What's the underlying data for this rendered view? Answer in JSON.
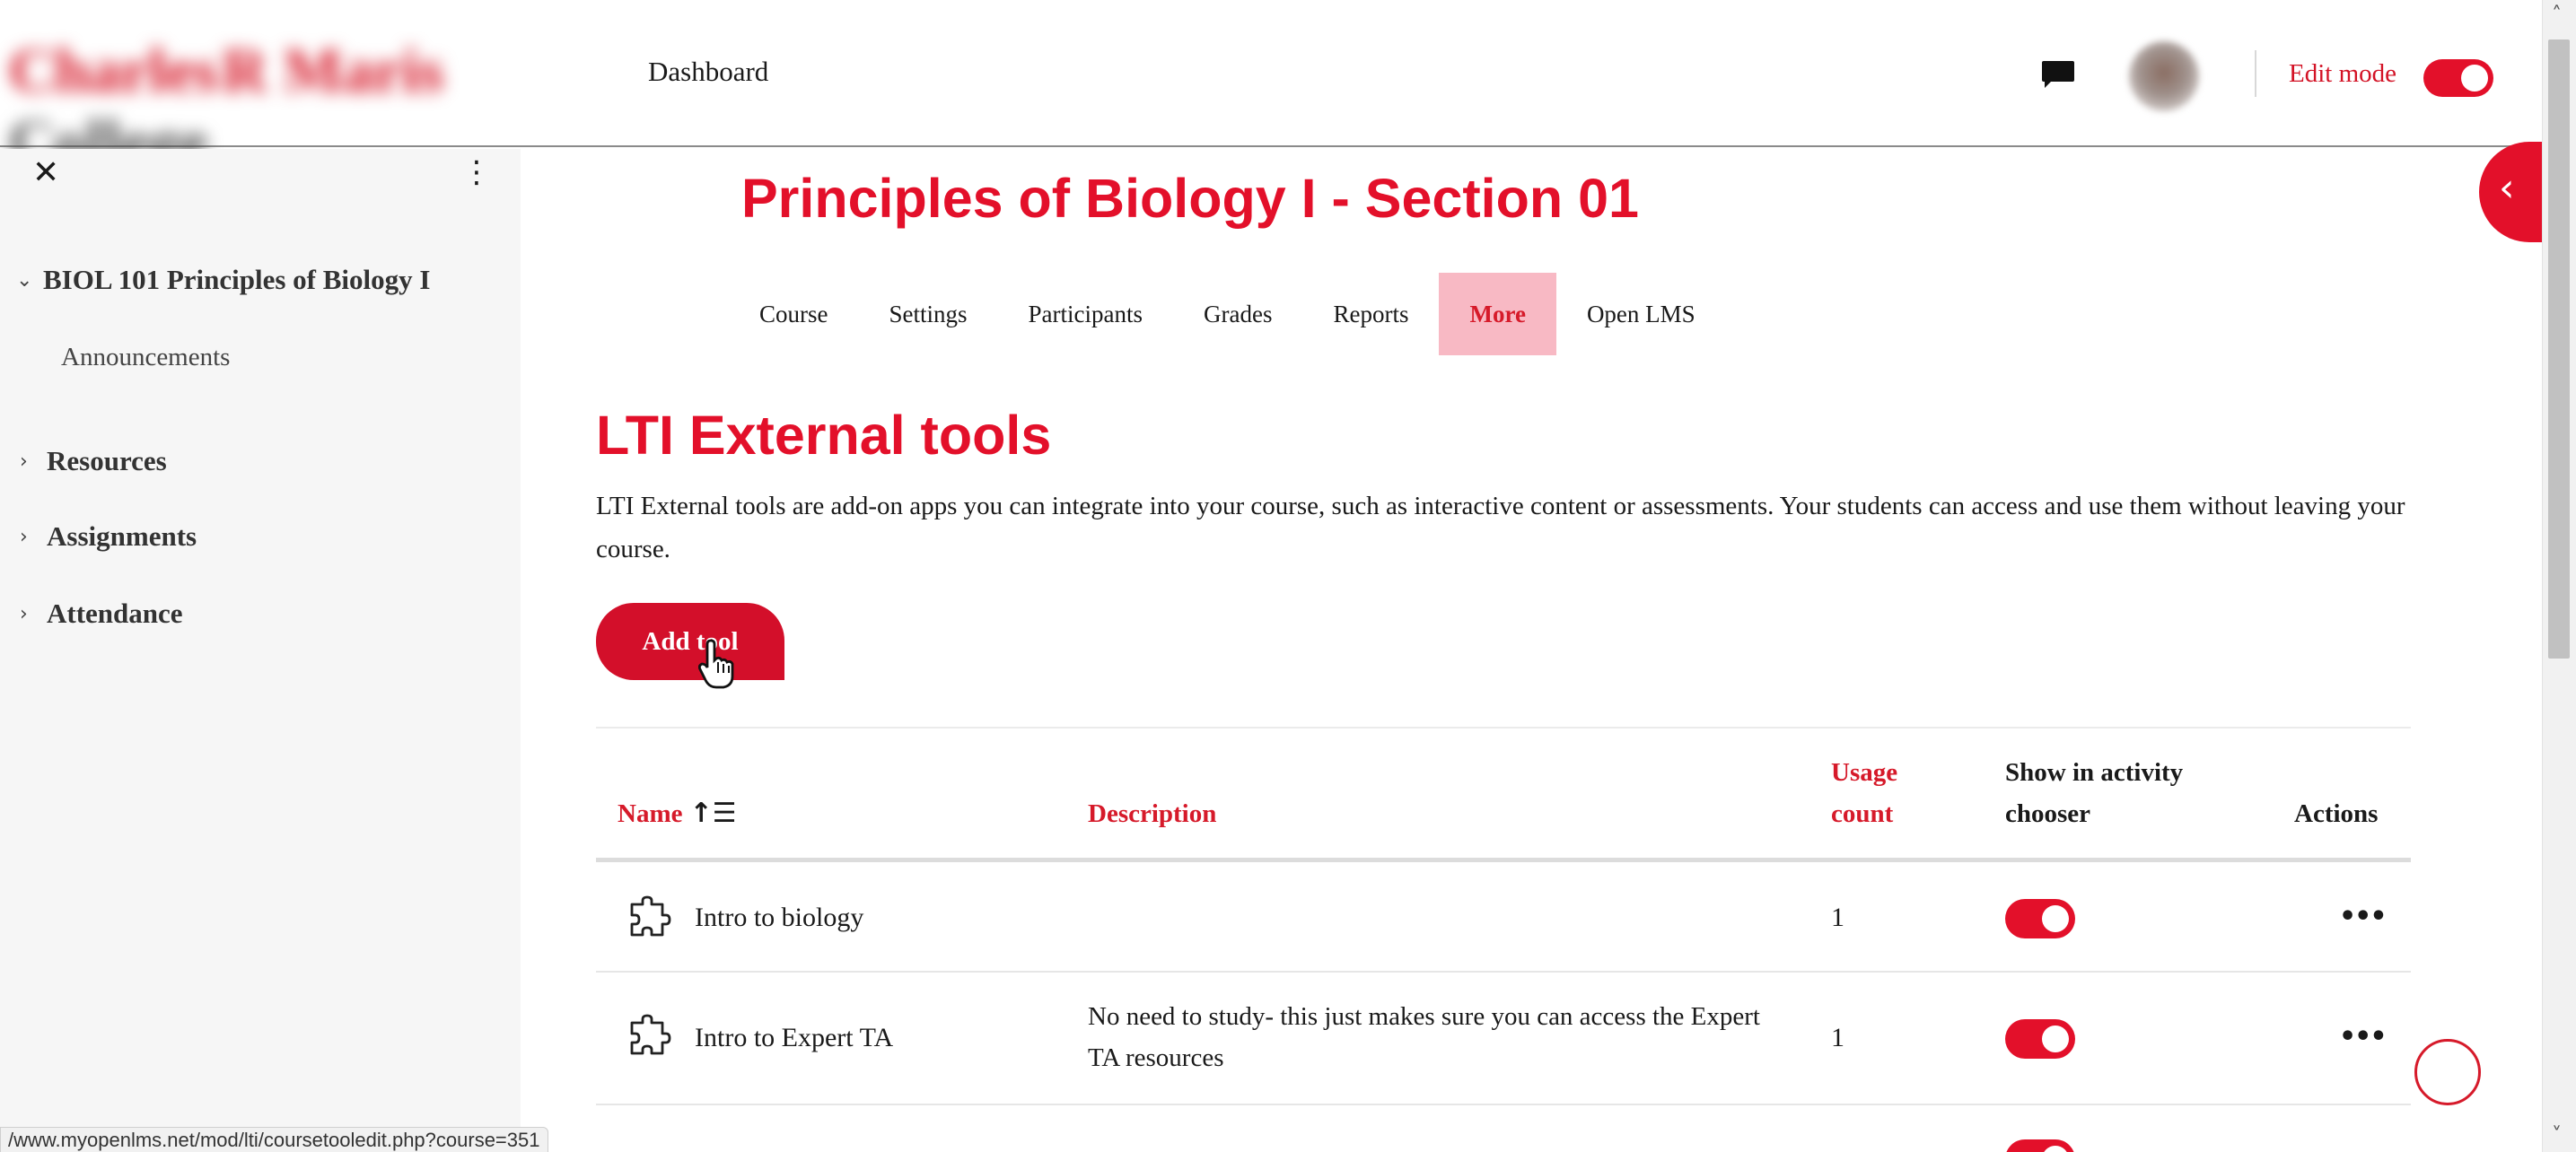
{
  "navbar": {
    "logo_text_part1": "Charles",
    "logo_text_part2": "R Maris",
    "logo_text_part3": "College",
    "dashboard_label": "Dashboard",
    "edit_mode_label": "Edit mode",
    "edit_mode_on": true,
    "icons": {
      "messages": "chat-bubble-icon",
      "avatar": "user-avatar"
    }
  },
  "sidebar": {
    "close_glyph": "✕",
    "menu_glyph": "⋮",
    "course_name": "BIOL 101 Principles of Biology I",
    "sub_items": [
      "Announcements"
    ],
    "sections": [
      "Resources",
      "Assignments",
      "Attendance"
    ]
  },
  "course": {
    "title": "Principles of Biology I - Section 01",
    "tabs": [
      "Course",
      "Settings",
      "Participants",
      "Grades",
      "Reports",
      "More",
      "Open LMS"
    ],
    "active_tab": "More"
  },
  "page": {
    "heading": "LTI External tools",
    "description": "LTI External tools are add-on apps you can integrate into your course, such as interactive content or assessments. Your students can access and use them without leaving your course.",
    "add_button_label": "Add tool"
  },
  "table": {
    "headers": {
      "name": "Name",
      "description": "Description",
      "usage_line1": "Usage",
      "usage_line2": "count",
      "show_line1": "Show in activity",
      "show_line2": "chooser",
      "actions": "Actions"
    },
    "rows": [
      {
        "name": "Intro to biology",
        "description": "",
        "usage": "1",
        "show_in_chooser": true
      },
      {
        "name": "Intro to Expert TA",
        "description": "No need to study- this just makes sure you can access the Expert TA resources",
        "usage": "1",
        "show_in_chooser": true
      }
    ],
    "row_actions_glyph": "•••"
  },
  "status_bar": {
    "url": "/www.myopenlms.net/mod/lti/coursetooledit.php?course=351"
  },
  "colors": {
    "accent": "#e3102a",
    "active_tab_bg": "#f8b9c4",
    "sidebar_bg": "#f6f6f6"
  }
}
